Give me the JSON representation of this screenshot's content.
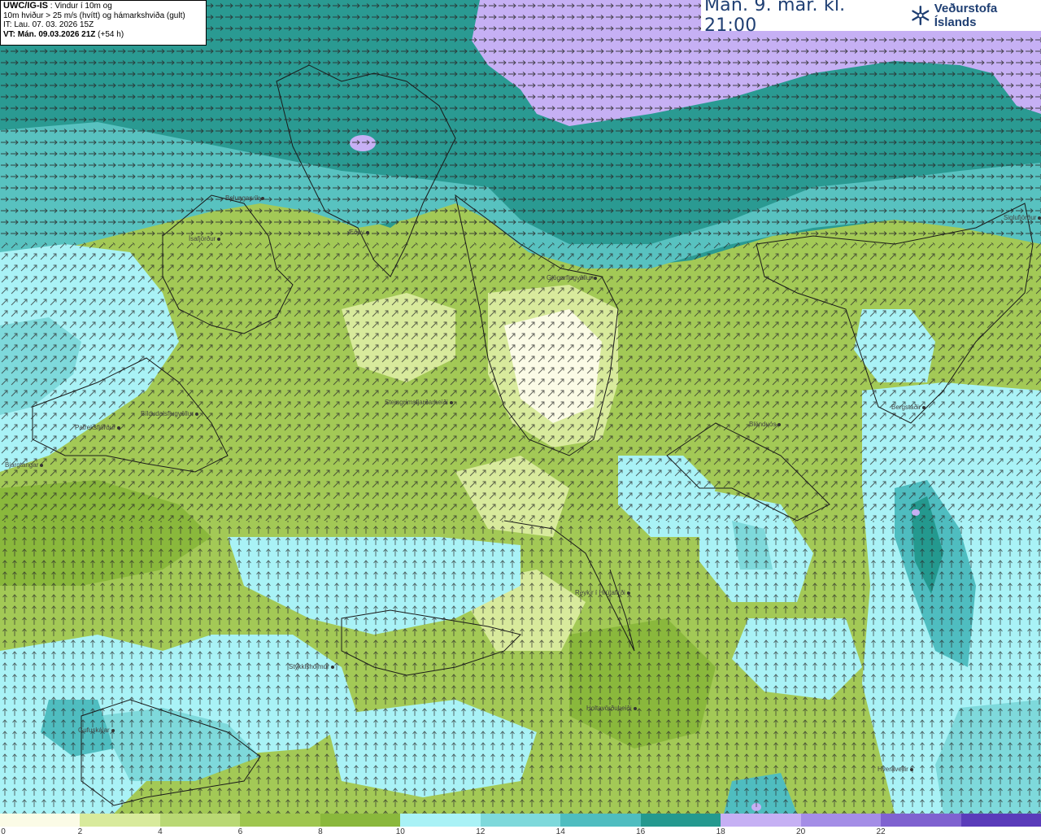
{
  "info": {
    "model_line": "UWC/IG-IS",
    "model_desc": " : Vindur í 10m og",
    "line2": "10m hviður > 25 m/s (hvítt) og hámarkshviða (gult)",
    "line3": "IT: Lau. 07. 03. 2026 15Z",
    "line4_bold": "VT: Mán. 09.03.2026 21Z",
    "line4_rest": " (+54 h)"
  },
  "brand": {
    "time": "Mán. 9. mar. kl. 21:00",
    "name": "Veðurstofa Íslands",
    "logo_icon": "snowflake-logo-icon"
  },
  "places": [
    {
      "name": "Bolungarvík"
    },
    {
      "name": "Ísafjörður"
    },
    {
      "name": "Æðey"
    },
    {
      "name": "Gjögurflugvöllur"
    },
    {
      "name": "Siglufjörður"
    },
    {
      "name": "Steingrímsfjarðarheiði"
    },
    {
      "name": "Bíldudalsflugvöllur"
    },
    {
      "name": "Patreksfjörður"
    },
    {
      "name": "Bjargtangar"
    },
    {
      "name": "Blönduós"
    },
    {
      "name": "Bergstaðir"
    },
    {
      "name": "Reykir í Hrútafirði"
    },
    {
      "name": "Stykkishólmur"
    },
    {
      "name": "Holtavörðuheiði"
    },
    {
      "name": "Gufuskálar"
    },
    {
      "name": "Hveravellir"
    }
  ],
  "legend": {
    "colors": [
      "#fbfbe6",
      "#d8ea9c",
      "#b9d874",
      "#9fc64e",
      "#8ab83c",
      "#a9f2f6",
      "#7ed9db",
      "#4fbdc0",
      "#24998f",
      "#c6b0f4",
      "#a48de6",
      "#7f62d0",
      "#5a3cba"
    ],
    "ticks": [
      "0",
      "2",
      "4",
      "6",
      "8",
      "10",
      "12",
      "14",
      "16",
      "18",
      "20",
      "22"
    ]
  }
}
